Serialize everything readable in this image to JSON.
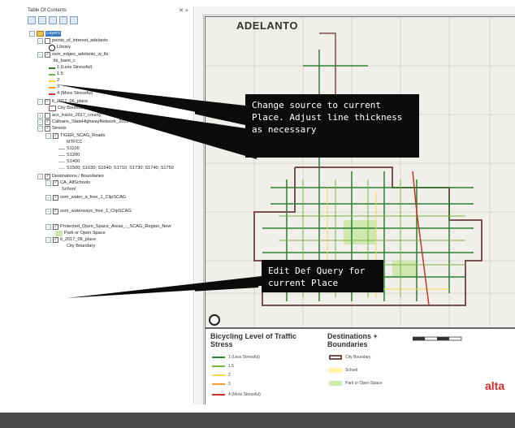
{
  "toc": {
    "title": "Table Of Contents",
    "close_glyph": "✕ ×",
    "items": [
      {
        "label": "Layers",
        "level": 0
      },
      {
        "label": "points_of_interest_adelanto",
        "level": 1
      },
      {
        "label": "Library",
        "level": 2
      },
      {
        "label": "osm_edges_adelanto_w_lts",
        "level": 1
      },
      {
        "label": "lts_base_c",
        "level": 2
      },
      {
        "label": "1 (Less Stressful)",
        "level": 2
      },
      {
        "label": "1.5",
        "level": 2
      },
      {
        "label": "2",
        "level": 2
      },
      {
        "label": "3",
        "level": 2
      },
      {
        "label": "4 (More Stressful)",
        "level": 2
      },
      {
        "label": "tl_2017_06_place",
        "level": 1
      },
      {
        "label": "City Boundary",
        "level": 2
      },
      {
        "label": "acs_tracts_2017_county",
        "level": 1
      },
      {
        "label": "Caltrans_StateHighwayNetwork_2015",
        "level": 1
      },
      {
        "label": "Streets",
        "level": 1
      },
      {
        "label": "TIGER_SCAG_Roads",
        "level": 2
      },
      {
        "label": "MTFCC",
        "level": 3
      },
      {
        "label": "S1100",
        "level": 3
      },
      {
        "label": "S1200",
        "level": 3
      },
      {
        "label": "S1400",
        "level": 3
      },
      {
        "label": "S1500; S1630; S1640; S1710; S1730; S1740; S1750",
        "level": 3
      },
      {
        "label": "Destinations / Boundaries",
        "level": 1
      },
      {
        "label": "CA_AllSchools",
        "level": 2
      },
      {
        "label": "School",
        "level": 3
      },
      {
        "label": "osm_water_a_free_1_ClipSCAG",
        "level": 2
      },
      {
        "label": "osm_waterways_free_1_ClipSCAG",
        "level": 2
      },
      {
        "label": "Protected_Open_Space_Areas_-_SCAG_Region_New",
        "level": 2
      },
      {
        "label": "Park or Open Space",
        "level": 3
      },
      {
        "label": "tl_2017_06_place",
        "level": 2
      },
      {
        "label": "City Boundary",
        "level": 3
      }
    ]
  },
  "map": {
    "title": "ADELANTO"
  },
  "legend": {
    "lts_title": "Bicycling Level of Traffic Stress",
    "lts_items": [
      "1 (Less Stressful)",
      "1.5",
      "2",
      "3",
      "4 (More Stressful)"
    ],
    "dest_title": "Destinations + Boundaries",
    "dest_items": [
      "City Boundary",
      "School",
      "Park or Open Space"
    ],
    "logo": "alta"
  },
  "callouts": {
    "top": "Change source to current Place. Adjust line thickness as necessary",
    "bottom": "Edit Def Query for current Place"
  },
  "colors": {
    "lts1": "#2e7d32",
    "lts15": "#7cb342",
    "lts2": "#f2d94e",
    "lts3": "#f39c34",
    "lts4": "#c0392b",
    "boundary": "#7a4f4f",
    "school": "#fff3a6",
    "park": "#cfe8b0"
  }
}
